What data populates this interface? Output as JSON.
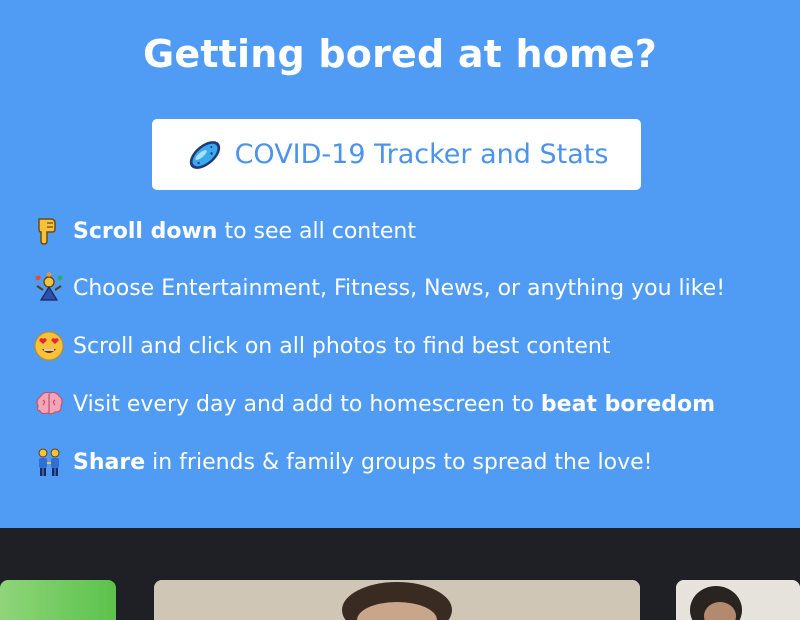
{
  "hero": {
    "title": "Getting bored at home?",
    "tracker_button": {
      "label": "COVID-19 Tracker and Stats",
      "icon": "microbe-icon"
    },
    "tips": [
      {
        "icon": "pointing-down-icon",
        "bold": "Scroll down",
        "text": " to see all content"
      },
      {
        "icon": "juggling-icon",
        "text": "Choose Entertainment, Fitness, News, or anything you like!"
      },
      {
        "icon": "heart-eyes-icon",
        "text": "Scroll and click on all photos to find best content"
      },
      {
        "icon": "brain-icon",
        "text": "Visit every day and add to homescreen to ",
        "bold": "beat boredom"
      },
      {
        "icon": "people-holding-hands-icon",
        "bold": "Share",
        "text": " in friends & family groups to spread the love!"
      }
    ]
  },
  "colors": {
    "hero_background": "#509cf5",
    "button_text": "#4b93ec",
    "gallery_background": "#1f2026"
  },
  "gallery": {
    "cards": [
      {
        "name": "photo-card-1"
      },
      {
        "name": "photo-card-2"
      },
      {
        "name": "photo-card-3"
      }
    ]
  }
}
